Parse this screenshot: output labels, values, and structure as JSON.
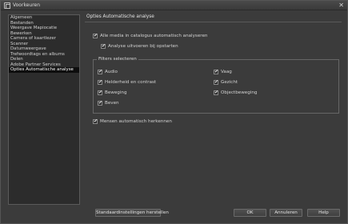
{
  "window": {
    "title": "Voorkeuren",
    "close_symbol": "✕"
  },
  "sidebar": {
    "items": [
      {
        "label": "Algemeen"
      },
      {
        "label": "Bestanden"
      },
      {
        "label": "Weergave Mapiocatie"
      },
      {
        "label": "Bewerken"
      },
      {
        "label": "Camera of kaartlezer"
      },
      {
        "label": "Scanner"
      },
      {
        "label": "Datumweergave"
      },
      {
        "label": "Trefwoordtags en albums"
      },
      {
        "label": "Delen"
      },
      {
        "label": "Adobe Partner Services"
      },
      {
        "label": "Opties Automatische analyse"
      }
    ],
    "active_index": 10
  },
  "panel": {
    "heading": "Opties Automatische analyse",
    "analyze_all": {
      "label": "Alle media in catalogus automatisch analyseren",
      "checked": true
    },
    "analyze_on_start": {
      "label": "Analyse uitvoeren bij opstarten",
      "checked": true
    },
    "filters": {
      "legend": "Filters selecteren",
      "left": [
        {
          "label": "Audio",
          "checked": true
        },
        {
          "label": "Helderheid en contrast",
          "checked": true
        },
        {
          "label": "Beweging",
          "checked": true
        },
        {
          "label": "Beven",
          "checked": true
        }
      ],
      "right": [
        {
          "label": "Vaag",
          "checked": true
        },
        {
          "label": "Gezicht",
          "checked": true
        },
        {
          "label": "Objectbeweging",
          "checked": true
        }
      ]
    },
    "recognize_people": {
      "label": "Mensen automatisch herkennen",
      "checked": true
    }
  },
  "buttons": {
    "reset": "Standaardinstellingen herstellen",
    "ok": "OK",
    "cancel": "Annuleren",
    "help": "Help"
  }
}
